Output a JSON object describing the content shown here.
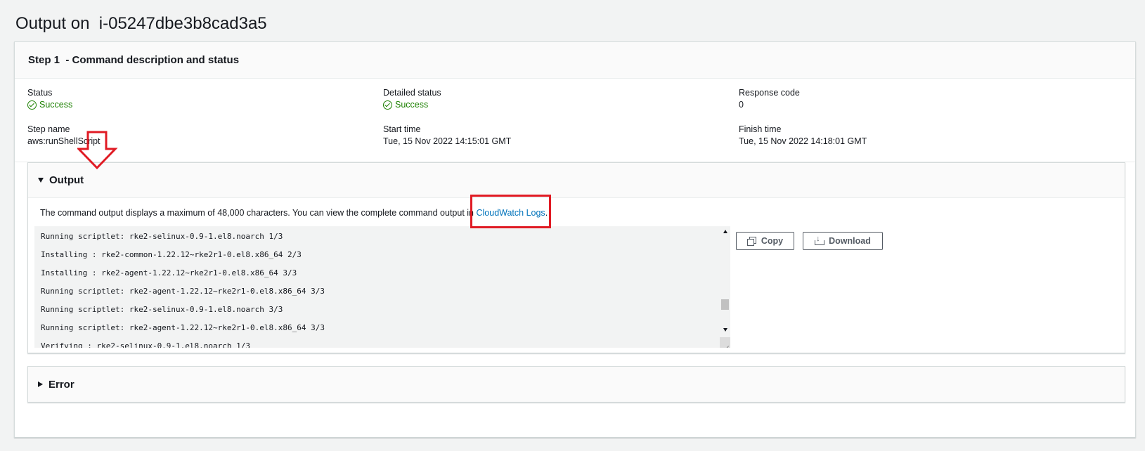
{
  "page": {
    "title_prefix": "Output on",
    "instance_id": "i-05247dbe3b8cad3a5"
  },
  "step_panel": {
    "header": "Step 1  - Command description and status",
    "fields": {
      "status_label": "Status",
      "status_value": "Success",
      "detailed_status_label": "Detailed status",
      "detailed_status_value": "Success",
      "response_code_label": "Response code",
      "response_code_value": "0",
      "step_name_label": "Step name",
      "step_name_value": "aws:runShellScript",
      "start_time_label": "Start time",
      "start_time_value": "Tue, 15 Nov 2022 14:15:01 GMT",
      "finish_time_label": "Finish time",
      "finish_time_value": "Tue, 15 Nov 2022 14:18:01 GMT"
    }
  },
  "output_section": {
    "title": "Output",
    "expanded": true,
    "note_text": "The command output displays a maximum of 48,000 characters. You can view the complete command output in ",
    "note_link": "CloudWatch Logs",
    "note_suffix": ".",
    "console_lines": [
      "Running scriptlet: rke2-selinux-0.9-1.el8.noarch 1/3",
      "Installing : rke2-common-1.22.12~rke2r1-0.el8.x86_64 2/3",
      "Installing : rke2-agent-1.22.12~rke2r1-0.el8.x86_64 3/3",
      "Running scriptlet: rke2-agent-1.22.12~rke2r1-0.el8.x86_64 3/3",
      "Running scriptlet: rke2-selinux-0.9-1.el8.noarch 3/3",
      "Running scriptlet: rke2-agent-1.22.12~rke2r1-0.el8.x86_64 3/3",
      "Verifying : rke2-selinux-0.9-1.el8.noarch 1/3"
    ],
    "copy_label": "Copy",
    "download_label": "Download"
  },
  "error_section": {
    "title": "Error",
    "expanded": false
  },
  "icons": {
    "status": "check-circle-icon",
    "copy": "copy-icon",
    "download": "download-icon"
  },
  "colors": {
    "success": "#1d8102",
    "link": "#0073bb",
    "annotation": "#e01b24",
    "background": "#f2f3f3"
  }
}
